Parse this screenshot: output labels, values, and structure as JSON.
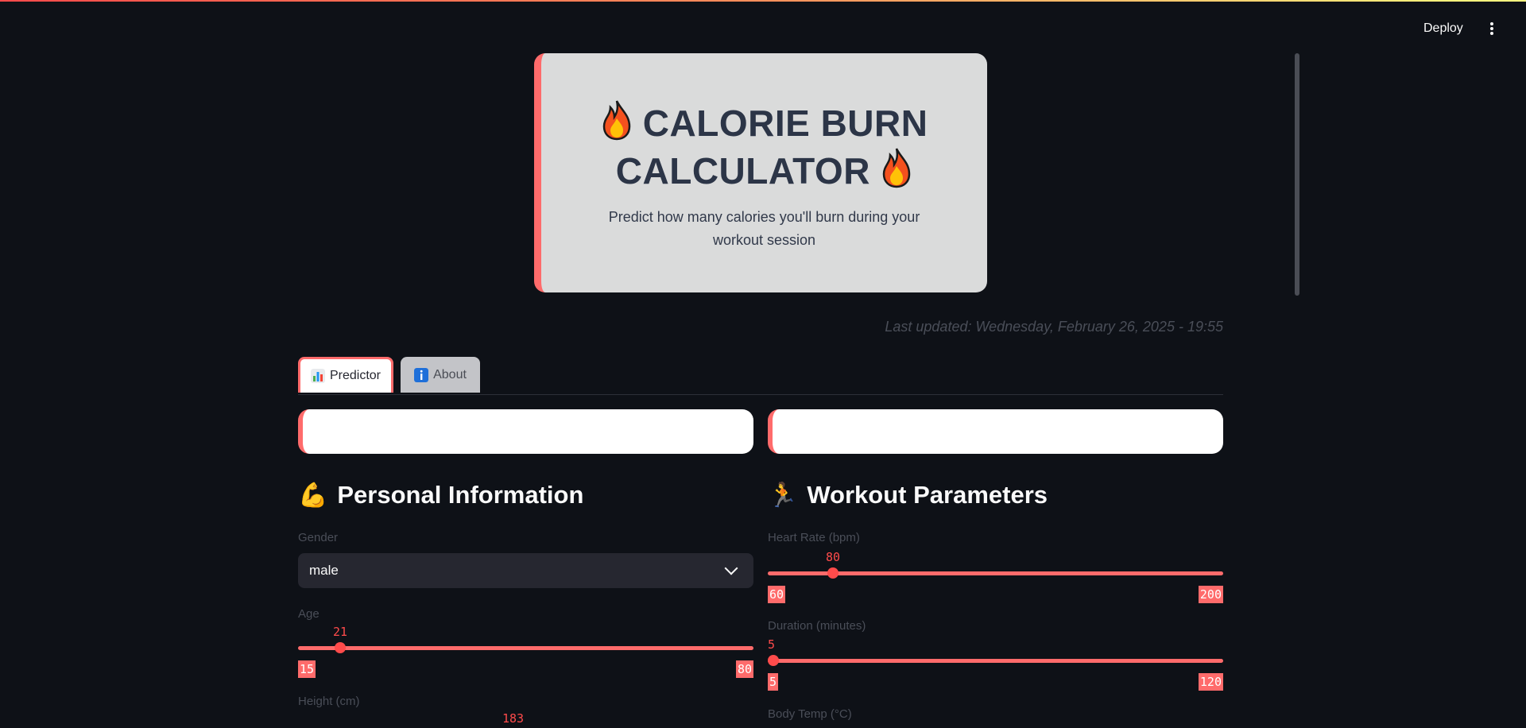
{
  "header": {
    "deploy_label": "Deploy"
  },
  "hero": {
    "title_line1": "CALORIE BURN",
    "title_line2": "CALCULATOR",
    "subtitle": "Predict how many calories you'll burn during your workout session"
  },
  "last_updated": "Last updated: Wednesday, February 26, 2025 - 19:55",
  "tabs": [
    {
      "label": "Predictor",
      "icon": "bar-chart-icon"
    },
    {
      "label": "About",
      "icon": "info-icon"
    }
  ],
  "personal": {
    "title": "Personal Information",
    "icon": "flexed-biceps-icon",
    "gender": {
      "label": "Gender",
      "value": "male"
    },
    "age": {
      "label": "Age",
      "value": "21",
      "min": "15",
      "max": "80",
      "fraction": 0.092
    },
    "height": {
      "label": "Height (cm)",
      "value": "183"
    }
  },
  "workout": {
    "title": "Workout Parameters",
    "icon": "person-running-icon",
    "heart_rate": {
      "label": "Heart Rate (bpm)",
      "value": "80",
      "min": "60",
      "max": "200",
      "fraction": 0.143
    },
    "duration": {
      "label": "Duration (minutes)",
      "value": "5",
      "min": "5",
      "max": "120",
      "fraction": 0
    },
    "body_temp": {
      "label": "Body Temp (°C)"
    }
  },
  "colors": {
    "accent": "#ff4b4b",
    "background": "#0e1117",
    "hero_bg": "#dadbdb"
  }
}
